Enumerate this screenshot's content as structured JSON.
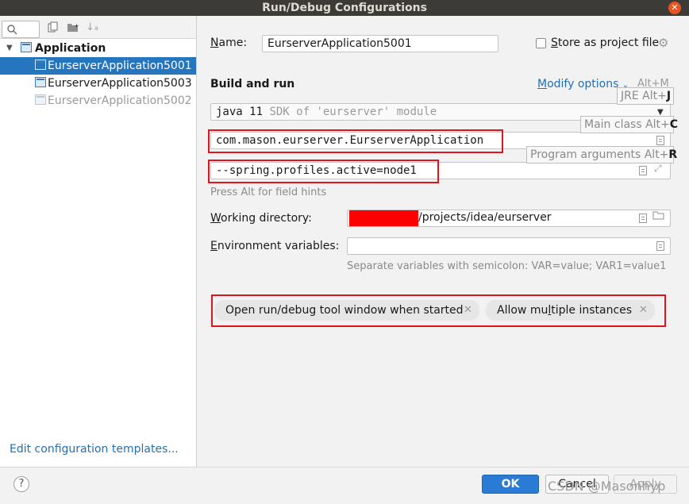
{
  "window": {
    "title": "Run/Debug Configurations"
  },
  "tree": {
    "group_label": "Application",
    "items": [
      {
        "label": "EurserverApplication5001"
      },
      {
        "label": "EurserverApplication5003"
      },
      {
        "label": "EurserverApplication5002"
      }
    ],
    "edit_templates_link": "Edit configuration templates..."
  },
  "form": {
    "name_label_pre": "",
    "name_label_u": "N",
    "name_label_post": "ame:",
    "name_value": "EurserverApplication5001",
    "store_label_u": "S",
    "store_label_post": "tore as project file",
    "build_run_heading": "Build and run",
    "modify_options_pre": "",
    "modify_options_u": "M",
    "modify_options_post": "odify options",
    "modify_options_shortcut": "Alt+M",
    "jre_java": "java 11",
    "jre_sdk": "SDK of 'eurserver' module",
    "main_class": "com.mason.eurserver.EurserverApplication",
    "program_args": "--spring.profiles.active=node1",
    "field_hint": "Press Alt for field hints",
    "workdir_label_u": "W",
    "workdir_label_post": "orking directory:",
    "workdir_value": "/projects/idea/eurserver",
    "env_label_u": "E",
    "env_label_post": "nvironment variables:",
    "env_hint": "Separate variables with semicolon: VAR=value; VAR1=value1",
    "chips": [
      {
        "pre": "Open run/debug tool window when started",
        "u": "",
        "post": ""
      },
      {
        "pre": "Allow mu",
        "u": "l",
        "post": "tiple instances"
      }
    ]
  },
  "popups": {
    "jre": {
      "text": "JRE Alt+",
      "key": "J"
    },
    "main_class": {
      "text": "Main class Alt+",
      "key": "C"
    },
    "program_args": {
      "text": "Program arguments Alt+",
      "key": "R"
    }
  },
  "footer": {
    "help": "?",
    "ok": "OK",
    "cancel": "Cancel",
    "apply": "Apply",
    "watermark": "CSDN @Masonhyp"
  },
  "colors": {
    "accent": "#2675bf",
    "highlight_box": "#e0141e",
    "redaction": "#ff0000"
  }
}
